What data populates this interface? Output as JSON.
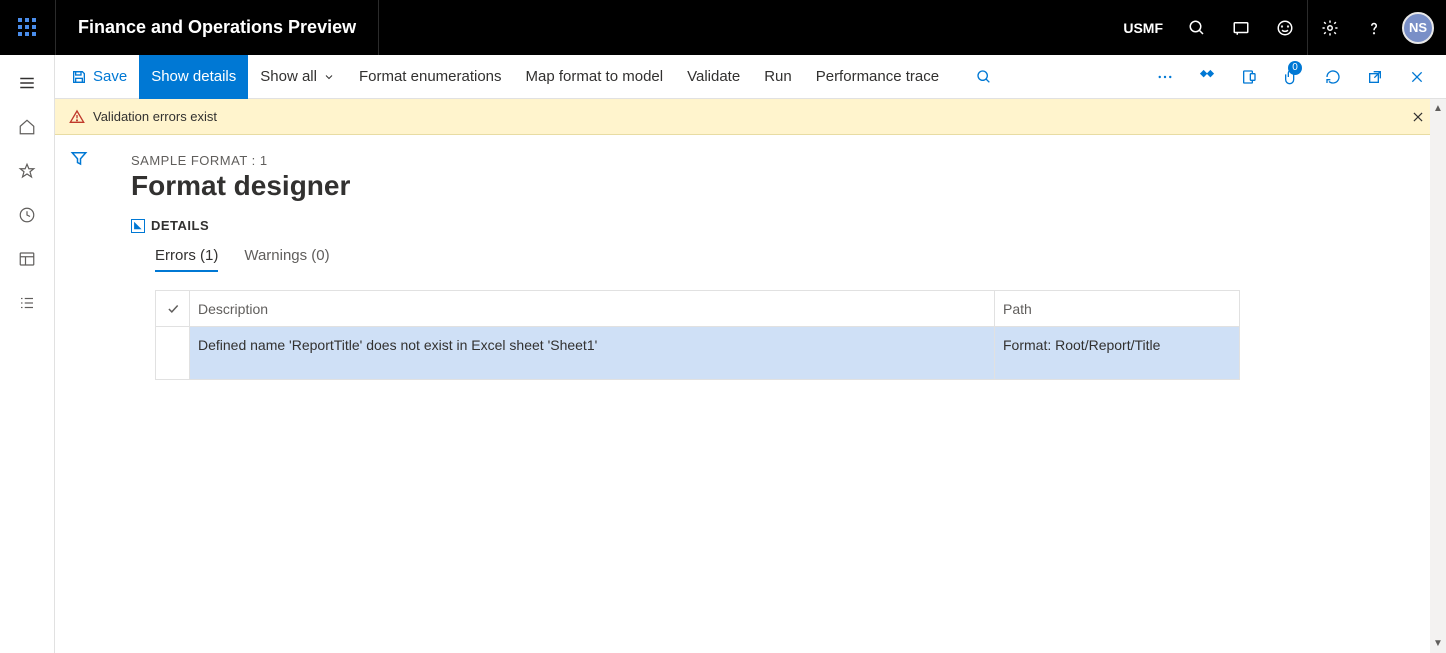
{
  "header": {
    "app_title": "Finance and Operations Preview",
    "company": "USMF",
    "avatar_initials": "NS"
  },
  "commands": {
    "save": "Save",
    "show_details": "Show details",
    "show_all": "Show all",
    "format_enumerations": "Format enumerations",
    "map_format": "Map format to model",
    "validate": "Validate",
    "run": "Run",
    "performance_trace": "Performance trace",
    "attachment_badge": "0"
  },
  "banner": {
    "message": "Validation errors exist"
  },
  "page": {
    "breadcrumb": "SAMPLE FORMAT : 1",
    "title": "Format designer",
    "details_label": "DETAILS"
  },
  "tabs": {
    "errors": "Errors (1)",
    "warnings": "Warnings (0)"
  },
  "grid": {
    "columns": {
      "description": "Description",
      "path": "Path"
    },
    "rows": [
      {
        "description": "Defined name 'ReportTitle' does not exist in Excel sheet 'Sheet1'",
        "path": "Format: Root/Report/Title"
      }
    ]
  }
}
